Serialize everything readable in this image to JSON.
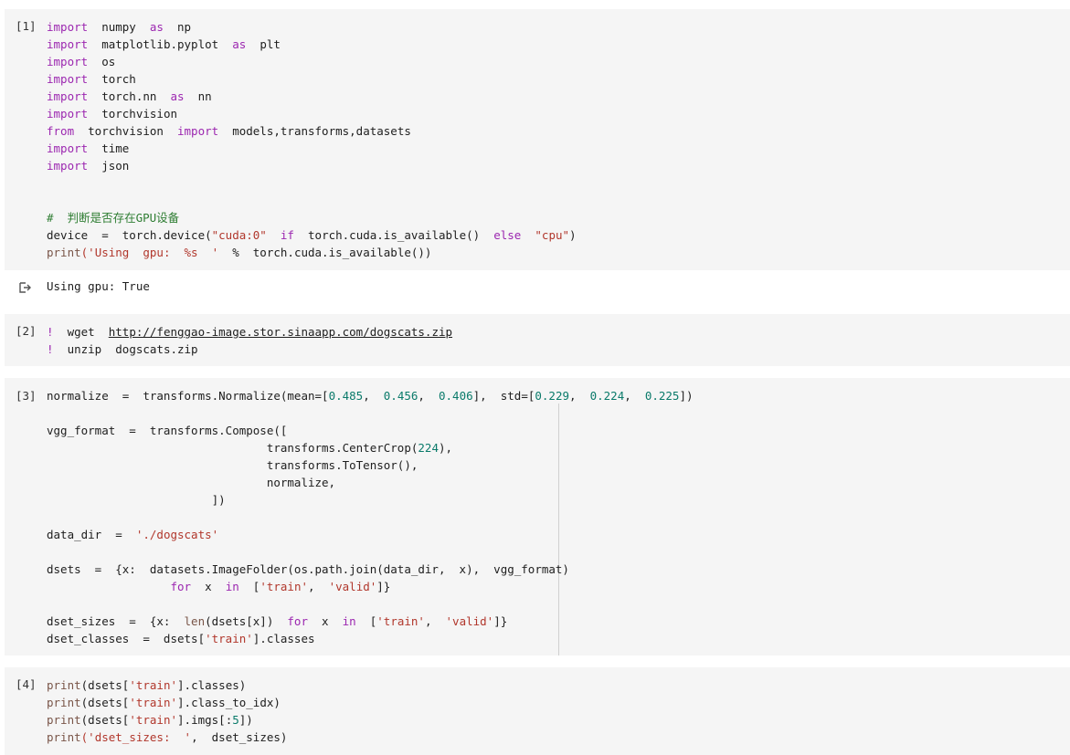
{
  "cells": [
    {
      "prompt": "[1]",
      "lines": [
        [
          [
            "kw",
            "import"
          ],
          [
            "pl",
            "  numpy  "
          ],
          [
            "kw",
            "as"
          ],
          [
            "pl",
            "  np"
          ]
        ],
        [
          [
            "kw",
            "import"
          ],
          [
            "pl",
            "  matplotlib.pyplot  "
          ],
          [
            "kw",
            "as"
          ],
          [
            "pl",
            "  plt"
          ]
        ],
        [
          [
            "kw",
            "import"
          ],
          [
            "pl",
            "  os"
          ]
        ],
        [
          [
            "kw",
            "import"
          ],
          [
            "pl",
            "  torch"
          ]
        ],
        [
          [
            "kw",
            "import"
          ],
          [
            "pl",
            "  torch.nn  "
          ],
          [
            "kw",
            "as"
          ],
          [
            "pl",
            "  nn"
          ]
        ],
        [
          [
            "kw",
            "import"
          ],
          [
            "pl",
            "  torchvision"
          ]
        ],
        [
          [
            "kw",
            "from"
          ],
          [
            "pl",
            "  torchvision  "
          ],
          [
            "kw",
            "import"
          ],
          [
            "pl",
            "  models,transforms,datasets"
          ]
        ],
        [
          [
            "kw",
            "import"
          ],
          [
            "pl",
            "  time"
          ]
        ],
        [
          [
            "kw",
            "import"
          ],
          [
            "pl",
            "  json"
          ]
        ],
        [],
        [],
        [
          [
            "cm",
            "#  判断是否存在GPU设备"
          ]
        ],
        [
          [
            "pl",
            "device  =  torch.device("
          ],
          [
            "str",
            "\"cuda:0\""
          ],
          [
            "pl",
            "  "
          ],
          [
            "kw",
            "if"
          ],
          [
            "pl",
            "  torch.cuda.is_available()  "
          ],
          [
            "kw",
            "else"
          ],
          [
            "pl",
            "  "
          ],
          [
            "str",
            "\"cpu\""
          ],
          [
            "pl",
            ")"
          ]
        ],
        [
          [
            "fn",
            "print"
          ],
          [
            "str",
            "('Using  gpu:  %s  '"
          ],
          [
            "pl",
            "  %  torch.cuda.is_available())"
          ]
        ]
      ],
      "output": "Using gpu: True"
    },
    {
      "prompt": "[2]",
      "lines": [
        [
          [
            "kw",
            "!"
          ],
          [
            "pl",
            "  wget  "
          ],
          [
            "link",
            "http://fenggao-image.stor.sinaapp.com/dogscats.zip"
          ]
        ],
        [
          [
            "kw",
            "!"
          ],
          [
            "pl",
            "  unzip  dogscats.zip"
          ]
        ]
      ]
    },
    {
      "prompt": "[3]",
      "lines": [
        [
          [
            "pl",
            "normalize  =  transforms.Normalize(mean=["
          ],
          [
            "num",
            "0.485"
          ],
          [
            "pl",
            ",  "
          ],
          [
            "num",
            "0.456"
          ],
          [
            "pl",
            ",  "
          ],
          [
            "num",
            "0.406"
          ],
          [
            "pl",
            "],  std=["
          ],
          [
            "num",
            "0.229"
          ],
          [
            "pl",
            ",  "
          ],
          [
            "num",
            "0.224"
          ],
          [
            "pl",
            ",  "
          ],
          [
            "num",
            "0.225"
          ],
          [
            "pl",
            "])"
          ]
        ],
        [],
        [
          [
            "pl",
            "vgg_format  =  transforms.Compose(["
          ]
        ],
        [
          [
            "pl",
            "                                transforms.CenterCrop("
          ],
          [
            "num",
            "224"
          ],
          [
            "pl",
            "),"
          ]
        ],
        [
          [
            "pl",
            "                                transforms.ToTensor(),"
          ]
        ],
        [
          [
            "pl",
            "                                normalize,"
          ]
        ],
        [
          [
            "pl",
            "                        ])"
          ]
        ],
        [],
        [
          [
            "pl",
            "data_dir  =  "
          ],
          [
            "str",
            "'./dogscats'"
          ]
        ],
        [],
        [
          [
            "pl",
            "dsets  =  {x:  datasets.ImageFolder(os.path.join(data_dir,  x),  vgg_format)"
          ]
        ],
        [
          [
            "pl",
            "                  "
          ],
          [
            "kw",
            "for"
          ],
          [
            "pl",
            "  x  "
          ],
          [
            "kw",
            "in"
          ],
          [
            "pl",
            "  ["
          ],
          [
            "str",
            "'train'"
          ],
          [
            "pl",
            ",  "
          ],
          [
            "str",
            "'valid'"
          ],
          [
            "pl",
            "]}"
          ]
        ],
        [],
        [
          [
            "pl",
            "dset_sizes  =  {x:  "
          ],
          [
            "fn",
            "len"
          ],
          [
            "pl",
            "(dsets[x])  "
          ],
          [
            "kw",
            "for"
          ],
          [
            "pl",
            "  x  "
          ],
          [
            "kw",
            "in"
          ],
          [
            "pl",
            "  ["
          ],
          [
            "str",
            "'train'"
          ],
          [
            "pl",
            ",  "
          ],
          [
            "str",
            "'valid'"
          ],
          [
            "pl",
            "]}"
          ]
        ],
        [
          [
            "pl",
            "dset_classes  =  dsets["
          ],
          [
            "str",
            "'train'"
          ],
          [
            "pl",
            "].classes"
          ]
        ]
      ]
    },
    {
      "prompt": "[4]",
      "lines": [
        [
          [
            "fn",
            "print"
          ],
          [
            "pl",
            "(dsets["
          ],
          [
            "str",
            "'train'"
          ],
          [
            "pl",
            "].classes)"
          ]
        ],
        [
          [
            "fn",
            "print"
          ],
          [
            "pl",
            "(dsets["
          ],
          [
            "str",
            "'train'"
          ],
          [
            "pl",
            "].class_to_idx)"
          ]
        ],
        [
          [
            "fn",
            "print"
          ],
          [
            "pl",
            "(dsets["
          ],
          [
            "str",
            "'train'"
          ],
          [
            "pl",
            "].imgs[:"
          ],
          [
            "num",
            "5"
          ],
          [
            "pl",
            "])"
          ]
        ],
        [
          [
            "fn",
            "print"
          ],
          [
            "str",
            "('dset_sizes:  '"
          ],
          [
            "pl",
            ",  dset_sizes)"
          ]
        ]
      ]
    }
  ],
  "icons": {
    "output": "output-arrow-icon"
  }
}
